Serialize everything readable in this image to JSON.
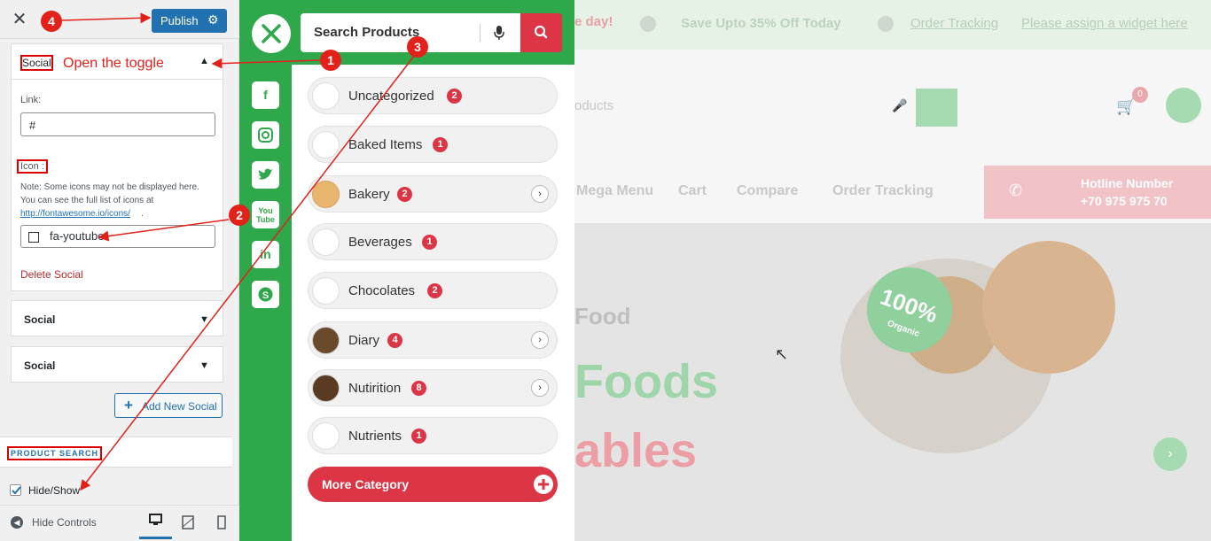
{
  "customizer": {
    "close_label": "✕",
    "publish_label": "Publish",
    "social_expanded": {
      "title": "Social",
      "toggle_note": "Open the toggle",
      "link_label": "Link:",
      "link_value": "#",
      "icon_label": "Icon :",
      "note_line1": "Note: Some icons may not be displayed here.",
      "note_line2": "You can see the full list of icons at",
      "note_link": "http://fontawesome.io/icons/",
      "note_end": ".",
      "icon_value": "fa-youtube",
      "delete_label": "Delete Social"
    },
    "collapsed_sections": [
      {
        "title": "Social"
      },
      {
        "title": "Social"
      }
    ],
    "add_social_label": "Add New Social",
    "product_search_label": "PRODUCT SEARCH",
    "hide_show_label": "Hide/Show",
    "hide_controls_label": "Hide Controls"
  },
  "annotations": [
    "1",
    "2",
    "3",
    "4"
  ],
  "search": {
    "placeholder": "Search Products"
  },
  "social_icons": [
    "facebook-icon",
    "instagram-icon",
    "twitter-icon",
    "youtube-icon",
    "linkedin-icon",
    "skype-icon"
  ],
  "categories": [
    {
      "name": "Uncategorized",
      "count": "2",
      "has_sub": false
    },
    {
      "name": "Baked Items",
      "count": "1",
      "has_sub": false
    },
    {
      "name": "Bakery",
      "count": "2",
      "has_sub": true
    },
    {
      "name": "Beverages",
      "count": "1",
      "has_sub": false
    },
    {
      "name": "Chocolates",
      "count": "2",
      "has_sub": false
    },
    {
      "name": "Diary",
      "count": "4",
      "has_sub": true
    },
    {
      "name": "Nutirition",
      "count": "8",
      "has_sub": true
    },
    {
      "name": "Nutrients",
      "count": "1",
      "has_sub": false
    }
  ],
  "more_category_label": "More Category",
  "site": {
    "promo_left": "e day!",
    "promo_mid": "Save Upto 35% Off Today",
    "promo_link1": "Order Tracking",
    "promo_link2": "Please assign a widget here",
    "search_frag": "oducts",
    "cart_count": "0",
    "nav": [
      "Mega Menu",
      "Cart",
      "Compare",
      "Order Tracking"
    ],
    "hotline_label": "Hotline Number",
    "hotline_number": "+70 975 975 70",
    "hero_small": "Food",
    "hero_big1": "Foods",
    "hero_big2": "ables",
    "badge_big": "100%",
    "badge_small": "Organic"
  },
  "colors": {
    "green": "#2ea84a",
    "red": "#dc3545",
    "wp_blue": "#2271b1",
    "annot_red": "#e3211b"
  }
}
